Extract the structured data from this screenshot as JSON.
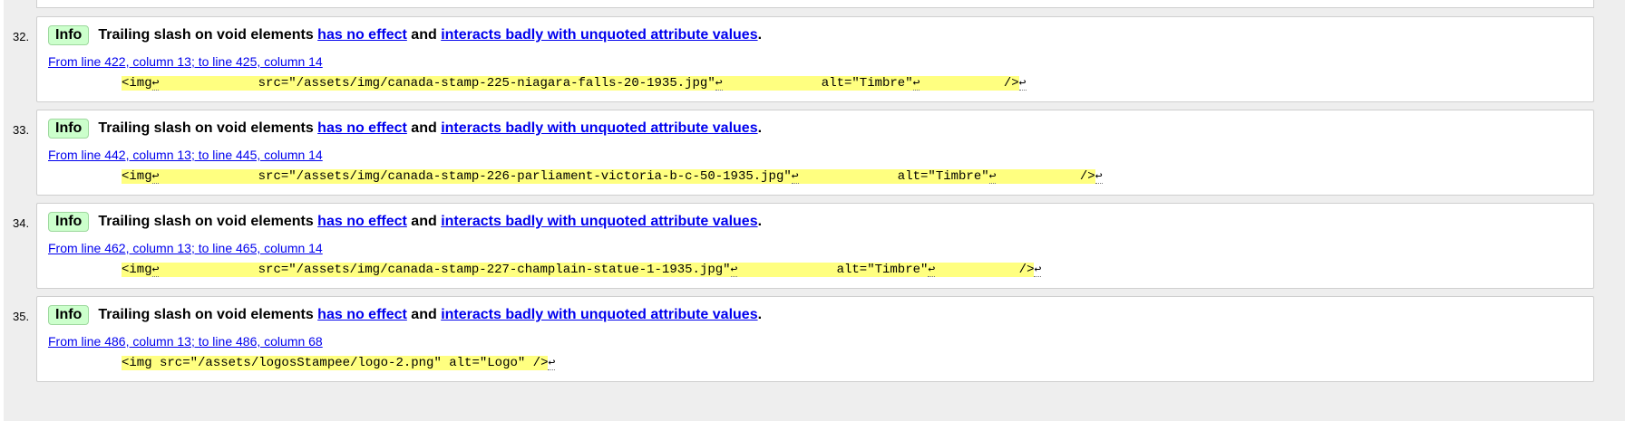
{
  "messages": [
    {
      "number": "32.",
      "badge": "Info",
      "text_before": "Trailing slash on void elements ",
      "link1": "has no effect",
      "text_middle": " and ",
      "link2": "interacts badly with unquoted attribute values",
      "text_after": ".",
      "location": "From line 422, column 13; to line 425, column 14",
      "extract": {
        "tag": "<img",
        "src": "             src=\"/assets/img/canada-stamp-225-niagara-falls-20-1935.jpg\"",
        "alt": "             alt=\"Timbre\"",
        "end": "           />"
      }
    },
    {
      "number": "33.",
      "badge": "Info",
      "text_before": "Trailing slash on void elements ",
      "link1": "has no effect",
      "text_middle": " and ",
      "link2": "interacts badly with unquoted attribute values",
      "text_after": ".",
      "location": "From line 442, column 13; to line 445, column 14",
      "extract": {
        "tag": "<img",
        "src": "             src=\"/assets/img/canada-stamp-226-parliament-victoria-b-c-50-1935.jpg\"",
        "alt": "             alt=\"Timbre\"",
        "end": "           />"
      }
    },
    {
      "number": "34.",
      "badge": "Info",
      "text_before": "Trailing slash on void elements ",
      "link1": "has no effect",
      "text_middle": " and ",
      "link2": "interacts badly with unquoted attribute values",
      "text_after": ".",
      "location": "From line 462, column 13; to line 465, column 14",
      "extract": {
        "tag": "<img",
        "src": "             src=\"/assets/img/canada-stamp-227-champlain-statue-1-1935.jpg\"",
        "alt": "             alt=\"Timbre\"",
        "end": "           />"
      }
    },
    {
      "number": "35.",
      "badge": "Info",
      "text_before": "Trailing slash on void elements ",
      "link1": "has no effect",
      "text_middle": " and ",
      "link2": "interacts badly with unquoted attribute values",
      "text_after": ".",
      "location": "From line 486, column 13; to line 486, column 68",
      "extract": {
        "single": "<img src=\"/assets/logosStampee/logo-2.png\" alt=\"Logo\" />"
      }
    }
  ],
  "newline_glyph": "↩",
  "colors": {
    "background": "#eeeeee",
    "card": "#ffffff",
    "info_badge": "#ccffcc",
    "link": "#0000ee",
    "highlight": "#ffff80"
  }
}
